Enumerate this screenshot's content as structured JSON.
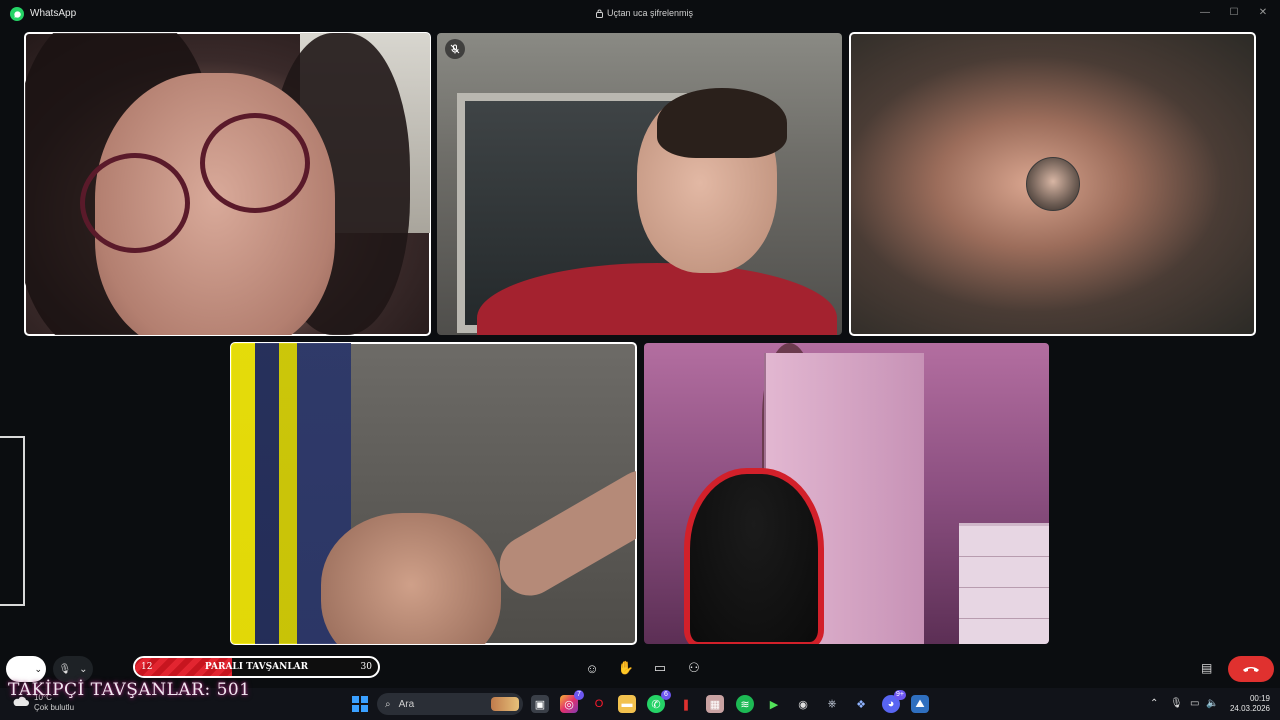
{
  "window": {
    "app_title": "WhatsApp",
    "encryption_label": "Uçtan uca şifrelenmiş",
    "controls": [
      "—",
      "☐",
      "✕"
    ]
  },
  "call": {
    "participants": [
      {
        "id": "p1",
        "muted": false
      },
      {
        "id": "p2",
        "muted": true
      },
      {
        "id": "p3",
        "muted": false,
        "video_off": true
      },
      {
        "id": "p4",
        "muted": false
      },
      {
        "id": "p5",
        "muted": false
      }
    ],
    "controls": {
      "end_call": "end-call",
      "icons": [
        "emoji-icon",
        "raise-hand-icon",
        "share-screen-icon",
        "participants-icon"
      ]
    }
  },
  "overlay": {
    "goal_bar": {
      "label": "PARALI TAVŞANLAR",
      "current": "12",
      "target": "30",
      "progress": 0.4
    },
    "title": "TAKİPÇİ TAVŞANLAR: 501"
  },
  "taskbar": {
    "weather_temp": "10°C",
    "weather_desc": "Çok bulutlu",
    "search_placeholder": "Ara",
    "badges": {
      "instagram": "7",
      "whatsapp": "6",
      "discord": "9+"
    },
    "time": "00:19",
    "date": "24.03.2026"
  },
  "colors": {
    "accent": "#25d366",
    "end_call": "#e0312f",
    "goal_fill": "#d21e28"
  }
}
